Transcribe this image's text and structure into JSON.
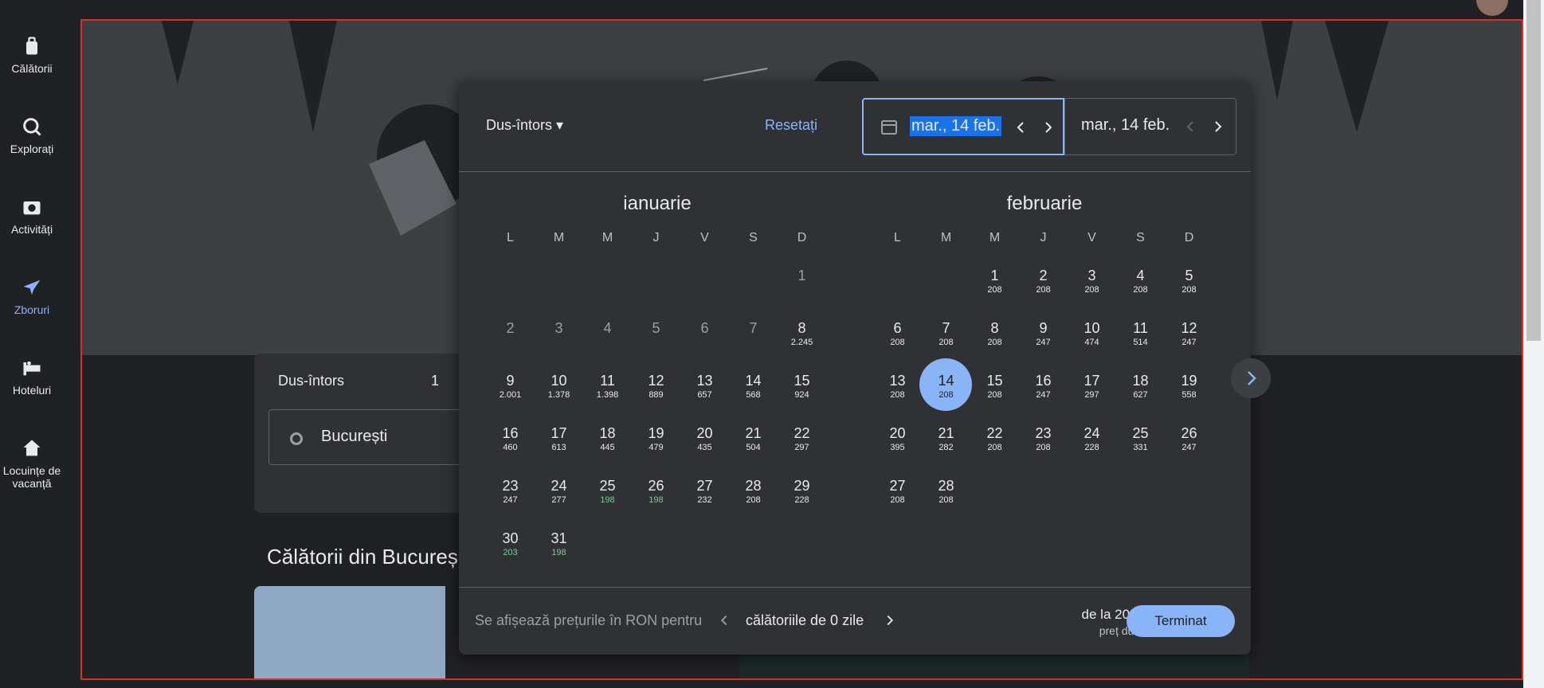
{
  "sidebar": {
    "items": [
      {
        "label": "Călătorii",
        "icon": "luggage-icon"
      },
      {
        "label": "Explorați",
        "icon": "explore-icon"
      },
      {
        "label": "Activități",
        "icon": "camera-icon"
      },
      {
        "label": "Zboruri",
        "icon": "flight-icon"
      },
      {
        "label": "Hoteluri",
        "icon": "hotel-icon"
      },
      {
        "label": "Locuințe de vacanță",
        "icon": "home-icon"
      }
    ]
  },
  "search": {
    "trip_type": "Dus-întors",
    "passengers": "1",
    "origin": "București",
    "section_title": "Călătorii din Bucureș"
  },
  "picker": {
    "trip_type": "Dus-întors",
    "reset": "Resetați",
    "depart_date": "mar., 14 feb.",
    "return_date": "mar., 14 feb.",
    "months": [
      {
        "title": "ianuarie",
        "weekdays": [
          "L",
          "M",
          "M",
          "J",
          "V",
          "S",
          "D"
        ],
        "offset": 6,
        "days": [
          {
            "d": "1",
            "p": "",
            "past": true
          },
          {
            "d": "2",
            "p": "",
            "past": true
          },
          {
            "d": "3",
            "p": "",
            "past": true
          },
          {
            "d": "4",
            "p": "",
            "past": true
          },
          {
            "d": "5",
            "p": "",
            "past": true
          },
          {
            "d": "6",
            "p": "",
            "past": true
          },
          {
            "d": "7",
            "p": "",
            "past": true
          },
          {
            "d": "8",
            "p": "2.245"
          },
          {
            "d": "9",
            "p": "2.001"
          },
          {
            "d": "10",
            "p": "1.378"
          },
          {
            "d": "11",
            "p": "1.398"
          },
          {
            "d": "12",
            "p": "889"
          },
          {
            "d": "13",
            "p": "657"
          },
          {
            "d": "14",
            "p": "568"
          },
          {
            "d": "15",
            "p": "924"
          },
          {
            "d": "16",
            "p": "460"
          },
          {
            "d": "17",
            "p": "613"
          },
          {
            "d": "18",
            "p": "445"
          },
          {
            "d": "19",
            "p": "479"
          },
          {
            "d": "20",
            "p": "435"
          },
          {
            "d": "21",
            "p": "504"
          },
          {
            "d": "22",
            "p": "297"
          },
          {
            "d": "23",
            "p": "247"
          },
          {
            "d": "24",
            "p": "277"
          },
          {
            "d": "25",
            "p": "198",
            "low": true
          },
          {
            "d": "26",
            "p": "198",
            "low": true
          },
          {
            "d": "27",
            "p": "232"
          },
          {
            "d": "28",
            "p": "208"
          },
          {
            "d": "29",
            "p": "228"
          },
          {
            "d": "30",
            "p": "203",
            "low": true
          },
          {
            "d": "31",
            "p": "198",
            "low": true
          }
        ]
      },
      {
        "title": "februarie",
        "weekdays": [
          "L",
          "M",
          "M",
          "J",
          "V",
          "S",
          "D"
        ],
        "offset": 2,
        "days": [
          {
            "d": "1",
            "p": "208"
          },
          {
            "d": "2",
            "p": "208"
          },
          {
            "d": "3",
            "p": "208"
          },
          {
            "d": "4",
            "p": "208"
          },
          {
            "d": "5",
            "p": "208"
          },
          {
            "d": "6",
            "p": "208"
          },
          {
            "d": "7",
            "p": "208"
          },
          {
            "d": "8",
            "p": "208"
          },
          {
            "d": "9",
            "p": "247"
          },
          {
            "d": "10",
            "p": "474"
          },
          {
            "d": "11",
            "p": "514"
          },
          {
            "d": "12",
            "p": "247"
          },
          {
            "d": "13",
            "p": "208"
          },
          {
            "d": "14",
            "p": "208",
            "selected": true
          },
          {
            "d": "15",
            "p": "208"
          },
          {
            "d": "16",
            "p": "247"
          },
          {
            "d": "17",
            "p": "297"
          },
          {
            "d": "18",
            "p": "627"
          },
          {
            "d": "19",
            "p": "558"
          },
          {
            "d": "20",
            "p": "395"
          },
          {
            "d": "21",
            "p": "282"
          },
          {
            "d": "22",
            "p": "208"
          },
          {
            "d": "23",
            "p": "208"
          },
          {
            "d": "24",
            "p": "228"
          },
          {
            "d": "25",
            "p": "331"
          },
          {
            "d": "26",
            "p": "247"
          },
          {
            "d": "27",
            "p": "208"
          },
          {
            "d": "28",
            "p": "208"
          }
        ]
      }
    ],
    "footer": {
      "note": "Se afișează prețurile în RON pentru",
      "duration": "călătoriile de 0 zile",
      "price": "de la 208 RON",
      "price_sub": "preț dus-întors",
      "done": "Terminat"
    }
  },
  "colors": {
    "accent": "#8ab4f8",
    "low_price": "#81c995",
    "bg": "#202124",
    "panel": "#303134"
  }
}
